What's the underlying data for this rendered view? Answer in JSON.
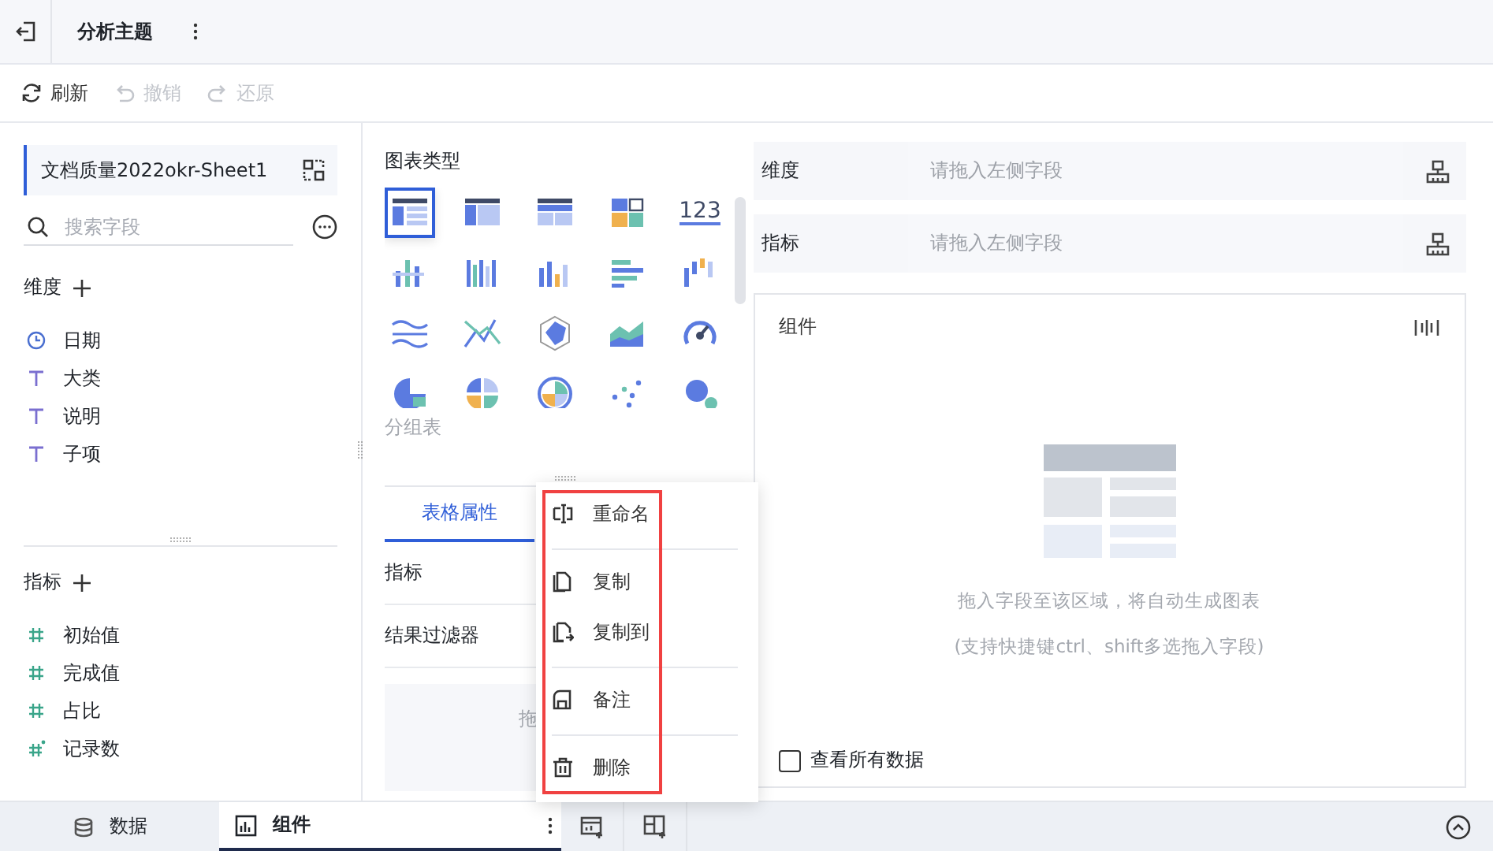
{
  "header": {
    "title": "分析主题"
  },
  "toolbar": [
    {
      "label": "刷新",
      "kind": "refresh",
      "disabled": false
    },
    {
      "label": "撤销",
      "kind": "undo",
      "disabled": true
    },
    {
      "label": "还原",
      "kind": "redo",
      "disabled": true
    }
  ],
  "sidebar": {
    "source": "文档质量2022okr-Sheet1",
    "search": {
      "placeholder": "搜索字段"
    },
    "sections": [
      {
        "title": "维度",
        "items": [
          {
            "label": "日期",
            "kind": "date"
          },
          {
            "label": "大类",
            "kind": "text"
          },
          {
            "label": "说明",
            "kind": "text"
          },
          {
            "label": "子项",
            "kind": "text"
          }
        ]
      },
      {
        "title": "指标",
        "items": [
          {
            "label": "初始值",
            "kind": "number"
          },
          {
            "label": "完成值",
            "kind": "number"
          },
          {
            "label": "占比",
            "kind": "number"
          },
          {
            "label": "记录数",
            "kind": "count"
          }
        ]
      }
    ]
  },
  "chart_types": {
    "title": "图表类型",
    "hover_label": "分组表",
    "items": [
      {
        "kind": "group-table",
        "selected": true
      },
      {
        "kind": "cross-table",
        "selected": false
      },
      {
        "kind": "detail-table",
        "selected": false
      },
      {
        "kind": "card",
        "selected": false
      },
      {
        "kind": "number",
        "label": "123",
        "selected": false
      },
      {
        "kind": "stacked-bar",
        "selected": false
      },
      {
        "kind": "multi-bar",
        "selected": false
      },
      {
        "kind": "bar",
        "selected": false
      },
      {
        "kind": "hbar",
        "selected": false
      },
      {
        "kind": "waterfall",
        "selected": false
      },
      {
        "kind": "wave",
        "selected": false
      },
      {
        "kind": "lines",
        "selected": false
      },
      {
        "kind": "radar",
        "selected": false
      },
      {
        "kind": "area",
        "selected": false
      },
      {
        "kind": "gauge",
        "selected": false
      },
      {
        "kind": "pie",
        "selected": false
      },
      {
        "kind": "pie-multi",
        "selected": false
      },
      {
        "kind": "rose",
        "selected": false
      },
      {
        "kind": "scatter",
        "selected": false
      },
      {
        "kind": "bubble",
        "selected": false
      }
    ]
  },
  "properties": {
    "tabs": [
      {
        "label": "表格属性",
        "selected": true
      }
    ],
    "rows": [
      "指标",
      "结果过滤器"
    ],
    "drop_hint": "拖"
  },
  "context_menu": {
    "groups": [
      [
        {
          "label": "重命名",
          "kind": "rename"
        }
      ],
      [
        {
          "label": "复制",
          "kind": "copy"
        },
        {
          "label": "复制到",
          "kind": "copy-to"
        }
      ],
      [
        {
          "label": "备注",
          "kind": "note"
        }
      ],
      [
        {
          "label": "删除",
          "kind": "delete"
        }
      ]
    ]
  },
  "shelves": [
    {
      "label": "维度",
      "placeholder": "请拖入左侧字段"
    },
    {
      "label": "指标",
      "placeholder": "请拖入左侧字段"
    }
  ],
  "component": {
    "title": "组件",
    "hint": "拖入字段至该区域，将自动生成图表",
    "sub_hint": "(支持快捷键ctrl、shift多选拖入字段)",
    "show_all": {
      "label": "查看所有数据",
      "checked": false
    }
  },
  "bottom_tabs": [
    {
      "label": "数据",
      "kind": "data",
      "selected": false
    },
    {
      "label": "组件",
      "kind": "chart",
      "selected": true
    }
  ]
}
